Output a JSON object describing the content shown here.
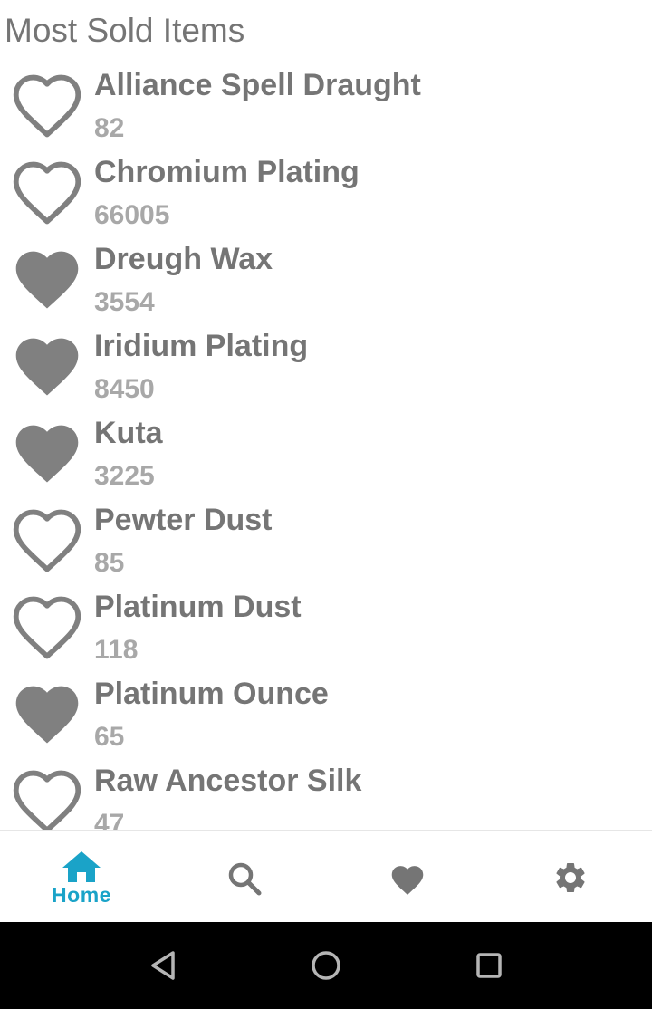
{
  "page": {
    "title": "Most Sold Items"
  },
  "items": [
    {
      "name": "Alliance Spell Draught",
      "count": "82",
      "favorite": false
    },
    {
      "name": "Chromium Plating",
      "count": "66005",
      "favorite": false
    },
    {
      "name": "Dreugh Wax",
      "count": "3554",
      "favorite": true
    },
    {
      "name": "Iridium Plating",
      "count": "8450",
      "favorite": true
    },
    {
      "name": "Kuta",
      "count": "3225",
      "favorite": true
    },
    {
      "name": "Pewter Dust",
      "count": "85",
      "favorite": false
    },
    {
      "name": "Platinum Dust",
      "count": "118",
      "favorite": false
    },
    {
      "name": "Platinum Ounce",
      "count": "65",
      "favorite": true
    },
    {
      "name": "Raw Ancestor Silk",
      "count": "47",
      "favorite": false
    }
  ],
  "bottom_nav": {
    "home": {
      "label": "Home",
      "icon": "home-icon",
      "active": true
    },
    "search": {
      "icon": "search-icon"
    },
    "favorites": {
      "icon": "heart-icon"
    },
    "settings": {
      "icon": "gear-icon"
    }
  },
  "system_nav": {
    "back": {
      "icon": "triangle-back-icon"
    },
    "home": {
      "icon": "circle-home-icon"
    },
    "recents": {
      "icon": "square-recents-icon"
    }
  },
  "colors": {
    "text_primary": "#757575",
    "text_secondary": "#a8a8a8",
    "heart": "#808080",
    "accent": "#1aa3c8",
    "nav_icon": "#757575"
  }
}
